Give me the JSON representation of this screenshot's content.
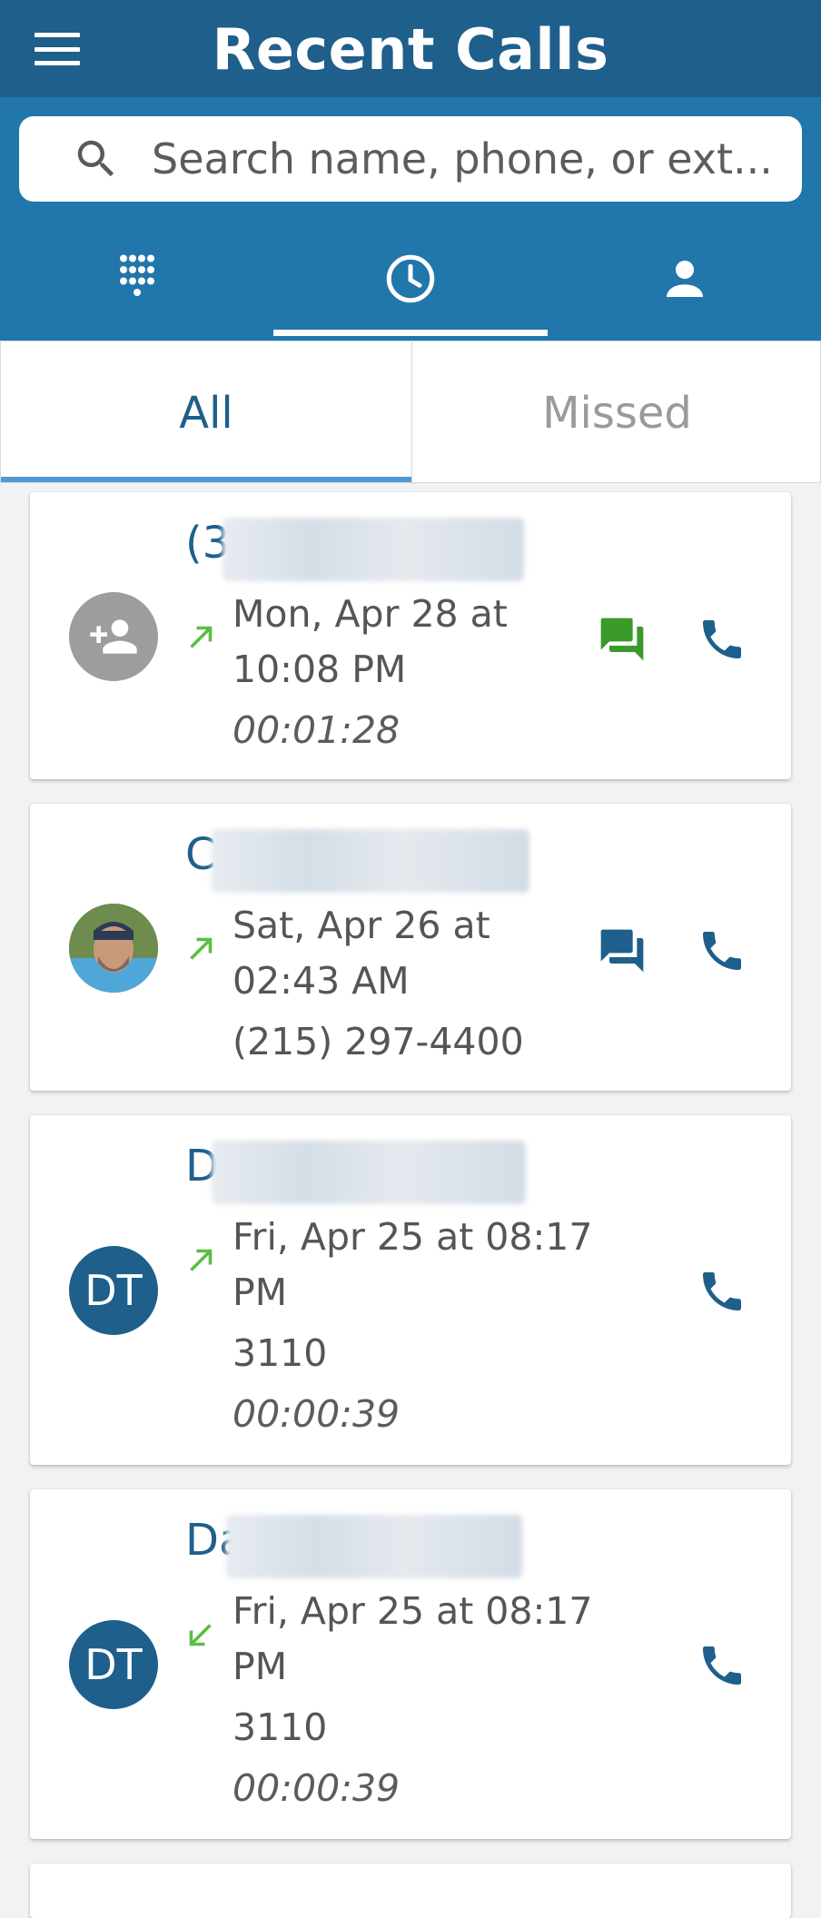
{
  "header": {
    "title": "Recent Calls",
    "menu_icon": "hamburger-menu-icon"
  },
  "search": {
    "placeholder": "Search name, phone, or ext..."
  },
  "nav_tabs": [
    {
      "icon": "dialpad-icon",
      "active": false
    },
    {
      "icon": "clock-icon",
      "active": true
    },
    {
      "icon": "person-icon",
      "active": false
    }
  ],
  "filter_tabs": {
    "all": "All",
    "missed": "Missed",
    "selected": "all"
  },
  "colors": {
    "primary_dark": "#1e5f8b",
    "primary": "#2176ab",
    "outgoing_arrow": "#5bbd45",
    "message_green": "#3a9a2a"
  },
  "calls": [
    {
      "name_visible": "(3",
      "direction": "outgoing",
      "date_line1": "Mon, Apr 28 at",
      "date_line2": "10:08 PM",
      "detail": "",
      "duration": "00:01:28",
      "has_message": true,
      "message_color": "#3a9a2a"
    },
    {
      "name_visible": "C",
      "direction": "outgoing",
      "date_line1": "Sat, Apr 26 at",
      "date_line2": "02:43 AM",
      "detail": "(215) 297-4400",
      "duration": "",
      "has_message": true,
      "message_color": "#1e5f8b"
    },
    {
      "name_visible": "D",
      "initials": "DT",
      "direction": "outgoing",
      "date_line1": "Fri, Apr 25 at 08:17",
      "date_line2": "PM",
      "detail": "3110",
      "duration": "00:00:39",
      "has_message": false
    },
    {
      "name_visible": "Da",
      "initials": "DT",
      "direction": "incoming",
      "date_line1": "Fri, Apr 25 at 08:17",
      "date_line2": "PM",
      "detail": "3110",
      "duration": "00:00:39",
      "has_message": false
    }
  ]
}
